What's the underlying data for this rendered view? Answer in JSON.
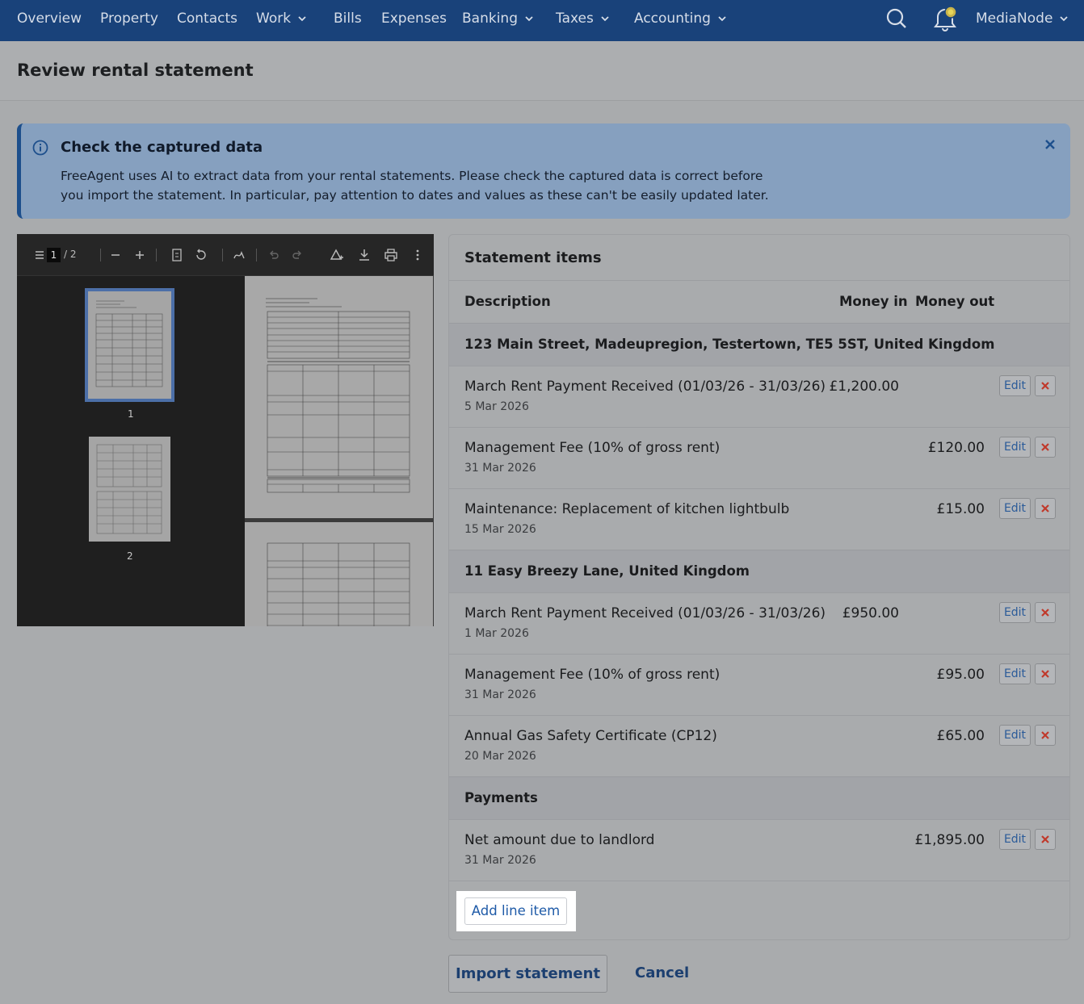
{
  "nav": {
    "items": [
      {
        "label": "Overview"
      },
      {
        "label": "Property"
      },
      {
        "label": "Contacts"
      },
      {
        "label": "Work"
      },
      {
        "label": "Bills"
      },
      {
        "label": "Expenses"
      },
      {
        "label": "Banking"
      },
      {
        "label": "Taxes"
      },
      {
        "label": "Accounting"
      }
    ],
    "account_label": "MediaNode",
    "search_icon": "search-icon",
    "bell_icon": "bell-icon"
  },
  "page": {
    "title": "Review rental statement"
  },
  "banner": {
    "title": "Check the captured data",
    "body": "FreeAgent uses AI to extract data from your rental statements. Please check the captured data is correct before you import the statement. In particular, pay attention to dates and values as these can't be easily updated later."
  },
  "viewer": {
    "current_page": "1",
    "total_pages": "/ 2",
    "thumb_labels": [
      "1",
      "2"
    ]
  },
  "statement": {
    "title": "Statement items",
    "col_description": "Description",
    "col_money_in": "Money in",
    "col_money_out": "Money out",
    "sections": [
      {
        "name": "123 Main Street, Madeupregion, Testertown, TE5 5ST, United Kingdom",
        "items": [
          {
            "description": "March Rent Payment Received (01/03/26 - 31/03/26)",
            "date": "5 Mar 2026",
            "money_in": "£1,200.00",
            "money_out": ""
          },
          {
            "description": "Management Fee (10% of gross rent)",
            "date": "31 Mar 2026",
            "money_in": "",
            "money_out": "£120.00"
          },
          {
            "description": "Maintenance: Replacement of kitchen lightbulb",
            "date": "15 Mar 2026",
            "money_in": "",
            "money_out": "£15.00"
          }
        ]
      },
      {
        "name": "11 Easy Breezy Lane, United Kingdom",
        "items": [
          {
            "description": "March Rent Payment Received (01/03/26 - 31/03/26)",
            "date": "1 Mar 2026",
            "money_in": "£950.00",
            "money_out": ""
          },
          {
            "description": "Management Fee (10% of gross rent)",
            "date": "31 Mar 2026",
            "money_in": "",
            "money_out": "£95.00"
          },
          {
            "description": "Annual Gas Safety Certificate (CP12)",
            "date": "20 Mar 2026",
            "money_in": "",
            "money_out": "£65.00"
          }
        ]
      },
      {
        "name": "Payments",
        "items": [
          {
            "description": "Net amount due to landlord",
            "date": "31 Mar 2026",
            "money_in": "",
            "money_out": "£1,895.00"
          }
        ]
      }
    ],
    "edit_label": "Edit",
    "add_line_item": "Add line item"
  },
  "actions": {
    "import": "Import statement",
    "cancel": "Cancel"
  },
  "colors": {
    "nav_bg": "#19427a",
    "accent": "#1f5ba8",
    "delete": "#c0392b",
    "banner_border": "#1d4f8c"
  }
}
